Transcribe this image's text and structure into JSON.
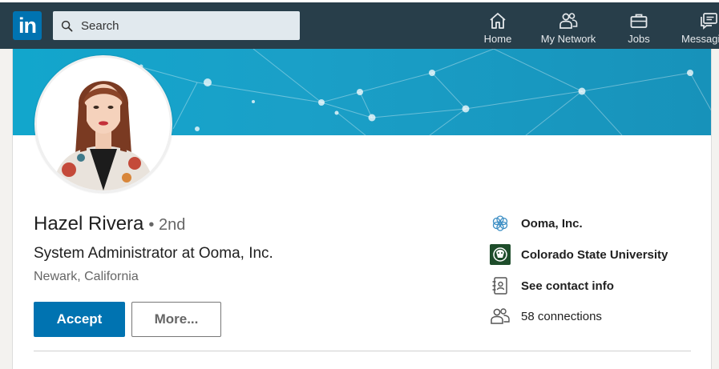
{
  "nav": {
    "logo_text": "in",
    "search_placeholder": "Search",
    "items": [
      {
        "label": "Home",
        "icon": "home-icon"
      },
      {
        "label": "My Network",
        "icon": "network-icon"
      },
      {
        "label": "Jobs",
        "icon": "briefcase-icon"
      },
      {
        "label": "Messaging",
        "icon": "messaging-icon"
      }
    ]
  },
  "profile": {
    "name": "Hazel Rivera",
    "degree": "• 2nd",
    "headline": "System Administrator at Ooma, Inc.",
    "location": "Newark, California",
    "accept_label": "Accept",
    "more_label": "More..."
  },
  "side": {
    "company": "Ooma, Inc.",
    "school": "Colorado State University",
    "contact": "See contact info",
    "connections": "58 connections"
  },
  "colors": {
    "nav_bg": "#283e4a",
    "brand_blue": "#0073b1",
    "banner": "#12a6cc"
  }
}
